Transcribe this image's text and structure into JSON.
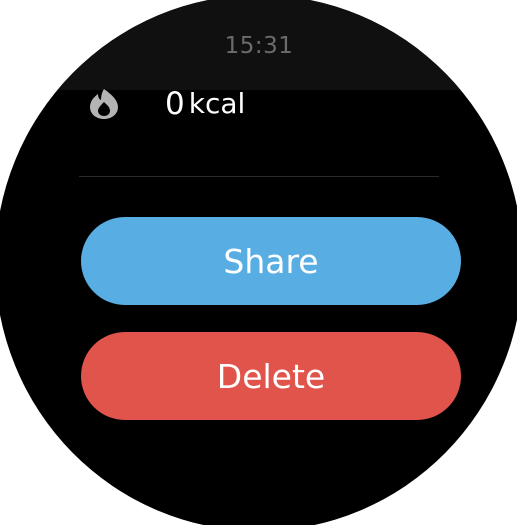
{
  "status_bar": {
    "time": "15:31"
  },
  "calories": {
    "value": "0",
    "unit": "kcal",
    "icon": "flame-icon"
  },
  "actions": {
    "share_label": "Share",
    "delete_label": "Delete"
  },
  "colors": {
    "background": "#000000",
    "share": "#58aee3",
    "delete": "#e0544b",
    "clock": "#6b6b6b",
    "icon": "#b4b4b4"
  }
}
